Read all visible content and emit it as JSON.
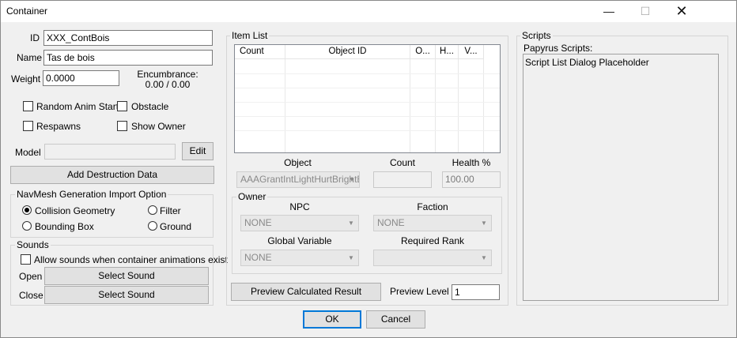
{
  "window": {
    "title": "Container",
    "min_glyph": "—",
    "max_glyph": "☐",
    "close_glyph": "✕"
  },
  "left": {
    "id_label": "ID",
    "id_value": "XXX_ContBois",
    "name_label": "Name",
    "name_value": "Tas de bois",
    "weight_label": "Weight",
    "weight_value": "0.0000",
    "encumbrance_label": "Encumbrance:",
    "encumbrance_value": "0.00 / 0.00",
    "checkboxes": [
      {
        "label": "Random Anim Start",
        "checked": false
      },
      {
        "label": "Obstacle",
        "checked": false
      },
      {
        "label": "Respawns",
        "checked": false
      },
      {
        "label": "Show Owner",
        "checked": false
      }
    ],
    "model_label": "Model",
    "model_value": "",
    "edit_label": "Edit",
    "add_destruction_label": "Add Destruction Data",
    "navmesh": {
      "title": "NavMesh Generation Import Option",
      "options": [
        {
          "label": "Collision Geometry",
          "selected": true
        },
        {
          "label": "Filter",
          "selected": false
        },
        {
          "label": "Bounding Box",
          "selected": false
        },
        {
          "label": "Ground",
          "selected": false
        }
      ]
    },
    "sounds": {
      "title": "Sounds",
      "allow_label": "Allow sounds when container animations exist",
      "open_label": "Open",
      "open_button": "Select Sound",
      "close_label": "Close",
      "close_button": "Select Sound"
    }
  },
  "items": {
    "title": "Item List",
    "columns": [
      "Count",
      "Object ID",
      "O...",
      "H...",
      "V..."
    ],
    "object_label": "Object",
    "object_value": "AAAGrantIntLightHurtBrightB",
    "count_label": "Count",
    "count_value": "",
    "health_label": "Health %",
    "health_value": "100.00",
    "owner": {
      "title": "Owner",
      "npc_label": "NPC",
      "npc_value": "NONE",
      "faction_label": "Faction",
      "faction_value": "NONE",
      "global_label": "Global Variable",
      "global_value": "NONE",
      "rank_label": "Required Rank",
      "rank_value": ""
    },
    "preview_button": "Preview Calculated Result",
    "preview_level_label": "Preview Level",
    "preview_level_value": "1"
  },
  "scripts": {
    "title": "Scripts",
    "papyrus_label": "Papyrus Scripts:",
    "placeholder": "Script List Dialog Placeholder"
  },
  "footer": {
    "ok": "OK",
    "cancel": "Cancel"
  }
}
